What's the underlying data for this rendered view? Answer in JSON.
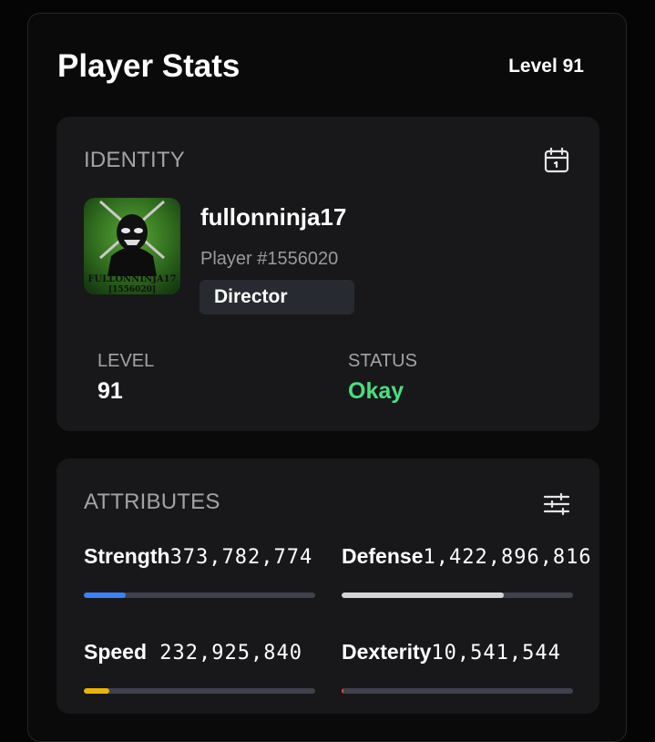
{
  "header": {
    "title": "Player Stats",
    "level_badge": "Level 91"
  },
  "identity": {
    "heading": "IDENTITY",
    "icon": "calendar-icon",
    "avatar_text": [
      "FULLONNINJA17",
      "[1556020]"
    ],
    "username": "fullonninja17",
    "player_id": "Player #1556020",
    "role": "Director",
    "stats": [
      {
        "label": "LEVEL",
        "value": "91",
        "color": "#ffffff"
      },
      {
        "label": "STATUS",
        "value": "Okay",
        "color": "#4ade80"
      }
    ]
  },
  "attributes": {
    "heading": "ATTRIBUTES",
    "icon": "sliders-icon",
    "items": [
      {
        "name": "Strength",
        "value": "373,782,774",
        "fill": 0.18,
        "color": "#3b82f6"
      },
      {
        "name": "Defense",
        "value": "1,422,896,816",
        "fill": 0.7,
        "color": "#d4d4d8"
      },
      {
        "name": "Speed",
        "value": " 232,925,840",
        "fill": 0.11,
        "color": "#eab308"
      },
      {
        "name": "Dexterity",
        "value": "10,541,544",
        "fill": 0.005,
        "color": "#ef4444"
      }
    ]
  }
}
